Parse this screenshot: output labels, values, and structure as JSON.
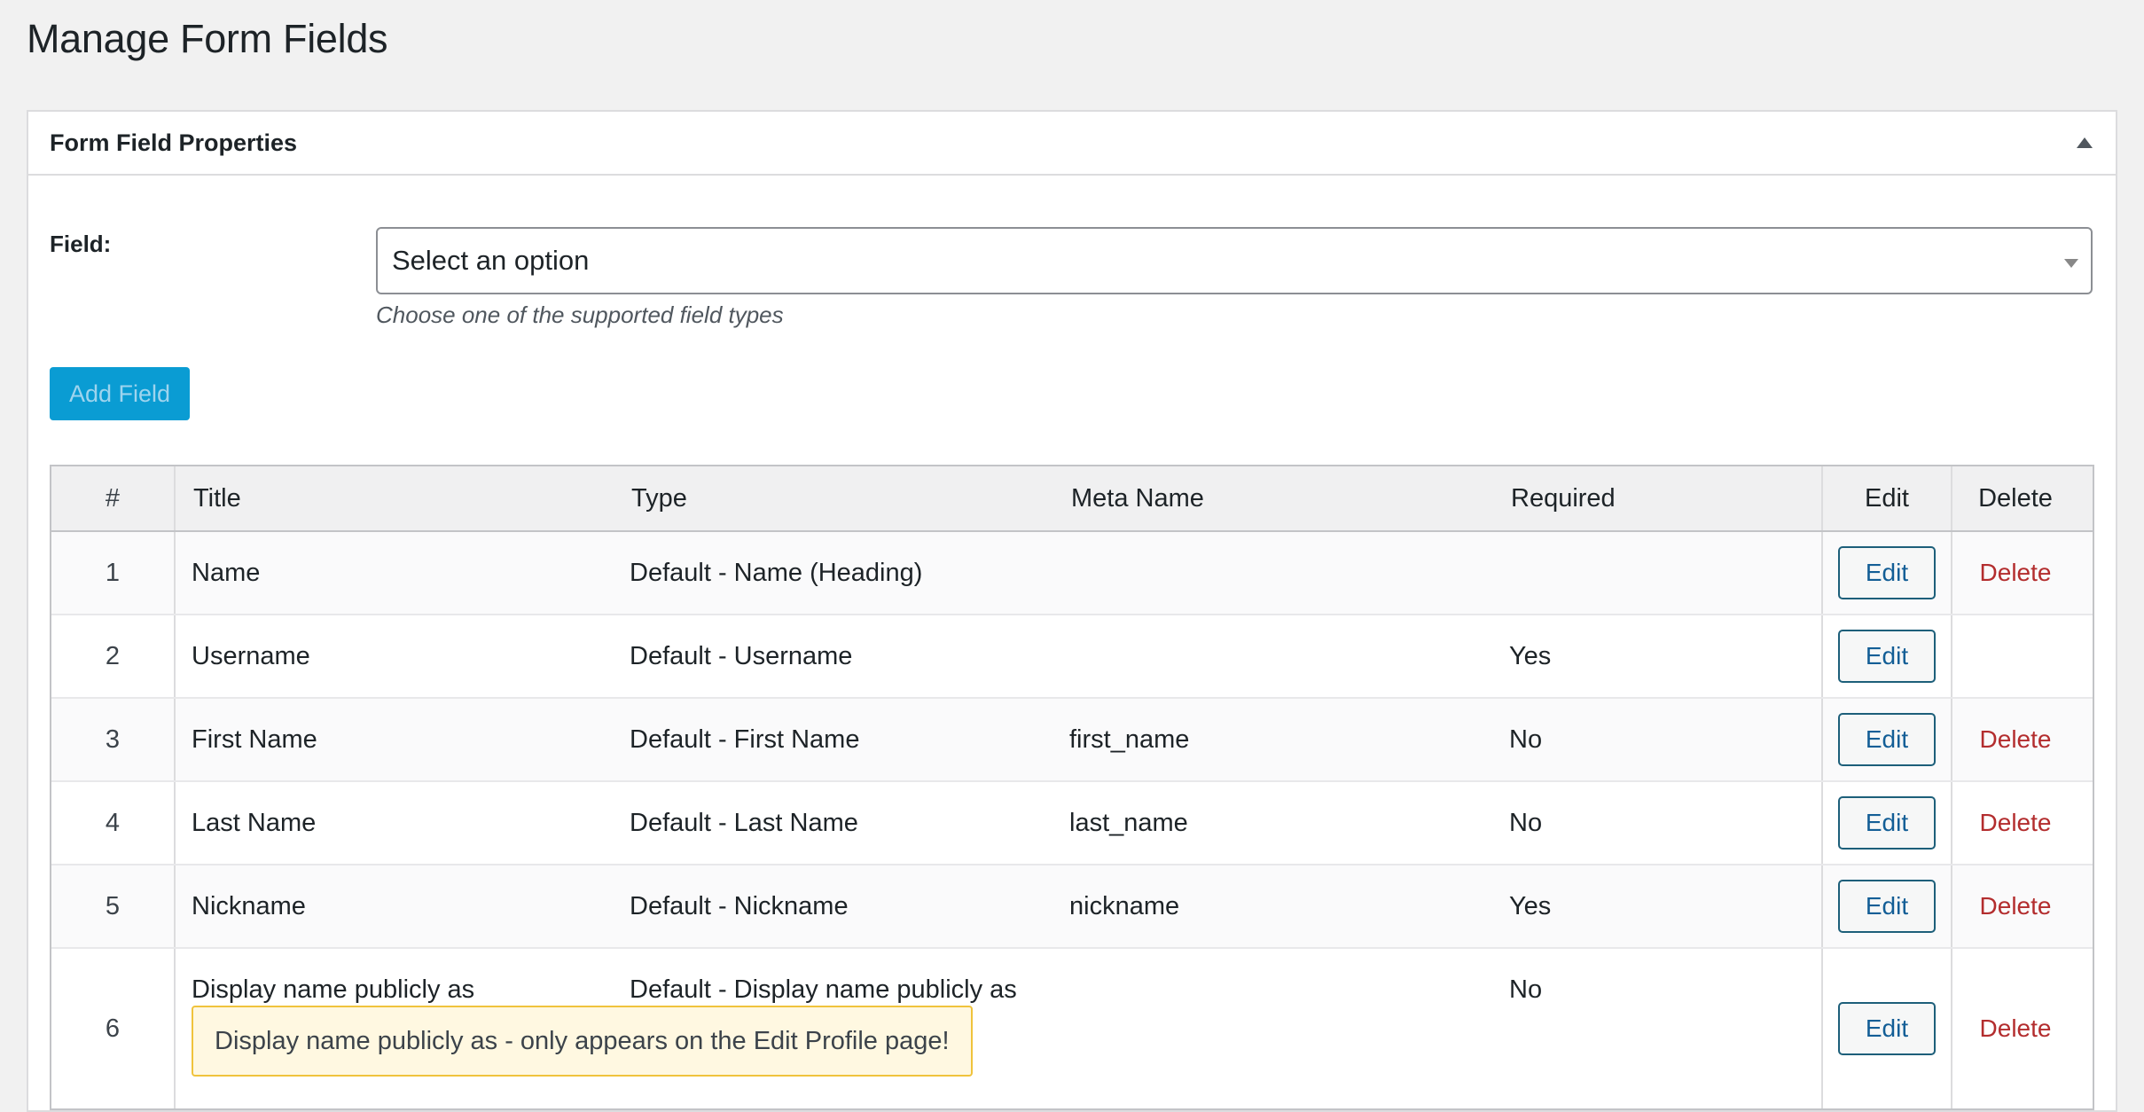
{
  "page": {
    "title": "Manage Form Fields"
  },
  "panel": {
    "title": "Form Field Properties",
    "field_label": "Field:",
    "select": {
      "value": "Select an option"
    },
    "description": "Choose one of the supported field types",
    "add_button": "Add Field"
  },
  "table": {
    "headers": {
      "num": "#",
      "title": "Title",
      "type": "Type",
      "meta": "Meta Name",
      "required": "Required",
      "edit": "Edit",
      "delete": "Delete"
    },
    "rows": [
      {
        "num": "1",
        "title": "Name",
        "type": "Default - Name (Heading)",
        "meta": "",
        "required": "",
        "edit": "Edit",
        "delete": "Delete"
      },
      {
        "num": "2",
        "title": "Username",
        "type": "Default - Username",
        "meta": "",
        "required": "Yes",
        "edit": "Edit",
        "delete": ""
      },
      {
        "num": "3",
        "title": "First Name",
        "type": "Default - First Name",
        "meta": "first_name",
        "required": "No",
        "edit": "Edit",
        "delete": "Delete"
      },
      {
        "num": "4",
        "title": "Last Name",
        "type": "Default - Last Name",
        "meta": "last_name",
        "required": "No",
        "edit": "Edit",
        "delete": "Delete"
      },
      {
        "num": "5",
        "title": "Nickname",
        "type": "Default - Nickname",
        "meta": "nickname",
        "required": "Yes",
        "edit": "Edit",
        "delete": "Delete"
      },
      {
        "num": "6",
        "title": "Display name publicly as",
        "type": "Default - Display name publicly as",
        "meta": "",
        "required": "No",
        "edit": "Edit",
        "delete": "Delete"
      }
    ],
    "notice": "Display name publicly as - only appears on the Edit Profile page!"
  },
  "colors": {
    "primary_button": "#0a9cd3",
    "link_blue": "#2271b1",
    "delete_red": "#b32d2e",
    "notice_border": "#f0c33c"
  }
}
